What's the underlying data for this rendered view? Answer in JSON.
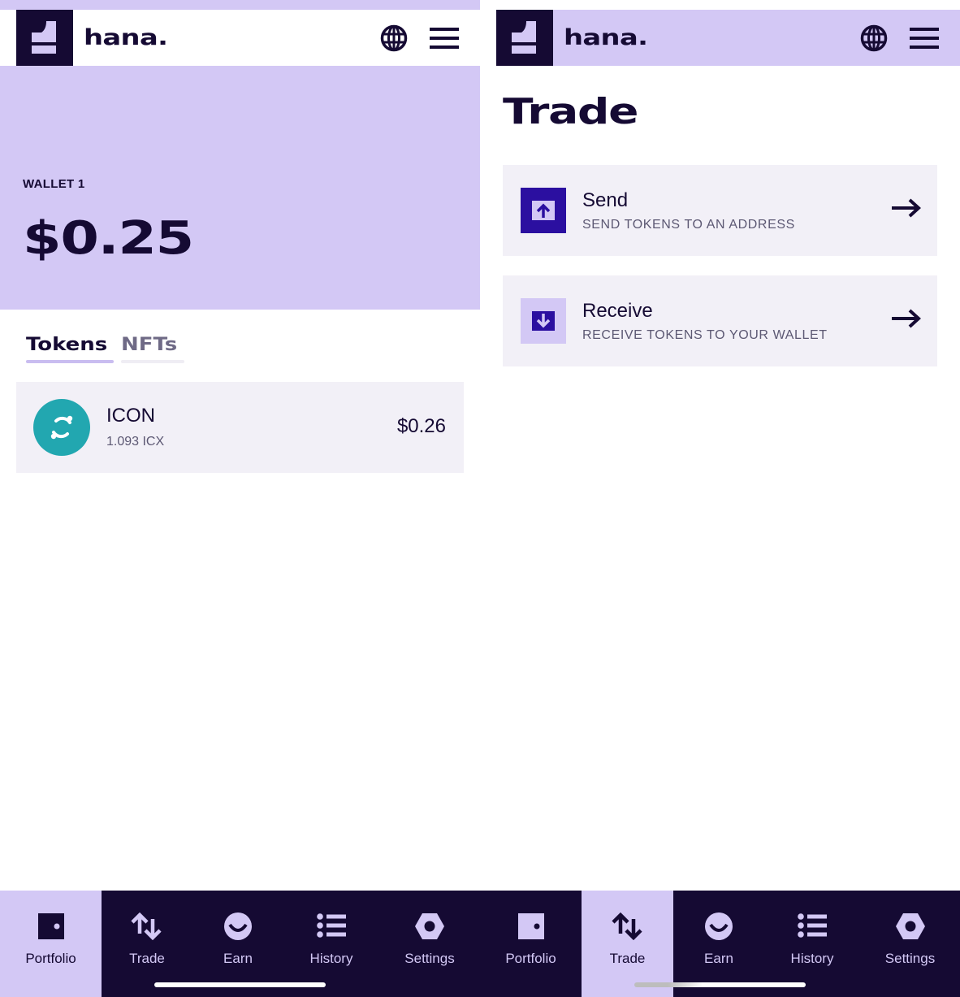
{
  "brand": {
    "name": "hana.",
    "colors": {
      "primary": "#150a33",
      "accent": "#d3c8f5",
      "card": "#f2f0f7",
      "token_teal": "#22a7b0",
      "send_icon_bg": "#2b0fa0"
    }
  },
  "header": {
    "globe_icon": "globe-icon",
    "menu_icon": "hamburger-menu-icon"
  },
  "portfolio": {
    "wallet_label": "WALLET 1",
    "balance": "$0.25",
    "tabs": [
      {
        "label": "Tokens",
        "active": true
      },
      {
        "label": "NFTs",
        "active": false
      }
    ],
    "tokens": [
      {
        "name": "ICON",
        "amount": "1.093 ICX",
        "value": "$0.26",
        "icon": "icon-icx-logo"
      }
    ]
  },
  "trade": {
    "title": "Trade",
    "actions": [
      {
        "title": "Send",
        "subtitle": "SEND TOKENS TO AN ADDRESS",
        "icon": "upload-arrow-icon"
      },
      {
        "title": "Receive",
        "subtitle": "RECEIVE TOKENS TO YOUR WALLET",
        "icon": "download-arrow-icon"
      }
    ]
  },
  "nav": {
    "items": [
      {
        "label": "Portfolio",
        "icon": "portfolio-icon"
      },
      {
        "label": "Trade",
        "icon": "trade-arrows-icon"
      },
      {
        "label": "Earn",
        "icon": "earn-smile-icon"
      },
      {
        "label": "History",
        "icon": "history-list-icon"
      },
      {
        "label": "Settings",
        "icon": "settings-hex-icon"
      }
    ],
    "left_active": "Portfolio",
    "right_active": "Trade"
  }
}
